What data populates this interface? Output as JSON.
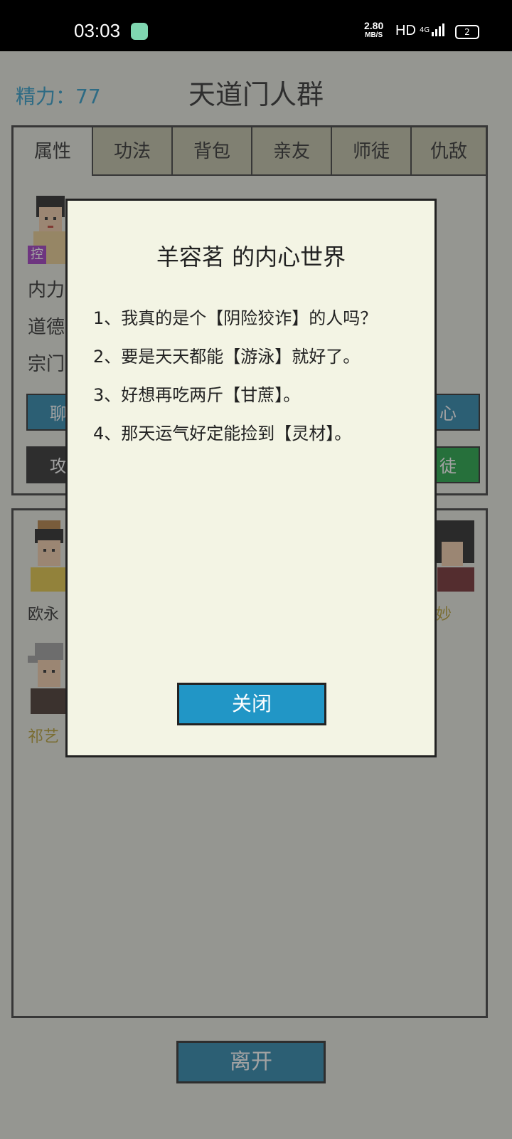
{
  "status_bar": {
    "time": "03:03",
    "net_speed_value": "2.80",
    "net_speed_unit": "MB/S",
    "hd_label": "HD",
    "signal_label": "4G",
    "battery_level": "2"
  },
  "header": {
    "energy": "精力：77",
    "title": "天道门人群"
  },
  "tabs": [
    {
      "label": "属性"
    },
    {
      "label": "功法"
    },
    {
      "label": "背包"
    },
    {
      "label": "亲友"
    },
    {
      "label": "师徒"
    },
    {
      "label": "仇敌"
    }
  ],
  "profile": {
    "control_badge": "控",
    "attr_labels": [
      "内力",
      "道德",
      "宗门"
    ]
  },
  "actions": {
    "chat_label": "聊",
    "heart_label": "心",
    "attack_label": "攻",
    "disciple_label": "徒"
  },
  "members": {
    "names": [
      "欧永",
      "妙",
      "祁艺"
    ]
  },
  "leave_button": "离开",
  "modal": {
    "title": "羊容茗 的内心世界",
    "lines": [
      "1、我真的是个【阴险狡诈】的人吗？",
      "2、要是天天都能【游泳】就好了。",
      "3、好想再吃两斤【甘蔗】。",
      "4、那天运气好定能捡到【灵材】。"
    ],
    "close_label": "关闭"
  },
  "colors": {
    "accent_blue": "#1d7fa8",
    "energy_text": "#2196c6",
    "green_button": "#13a03a",
    "member_gold": "#b39a2a",
    "control_badge": "#9b2fbf"
  }
}
